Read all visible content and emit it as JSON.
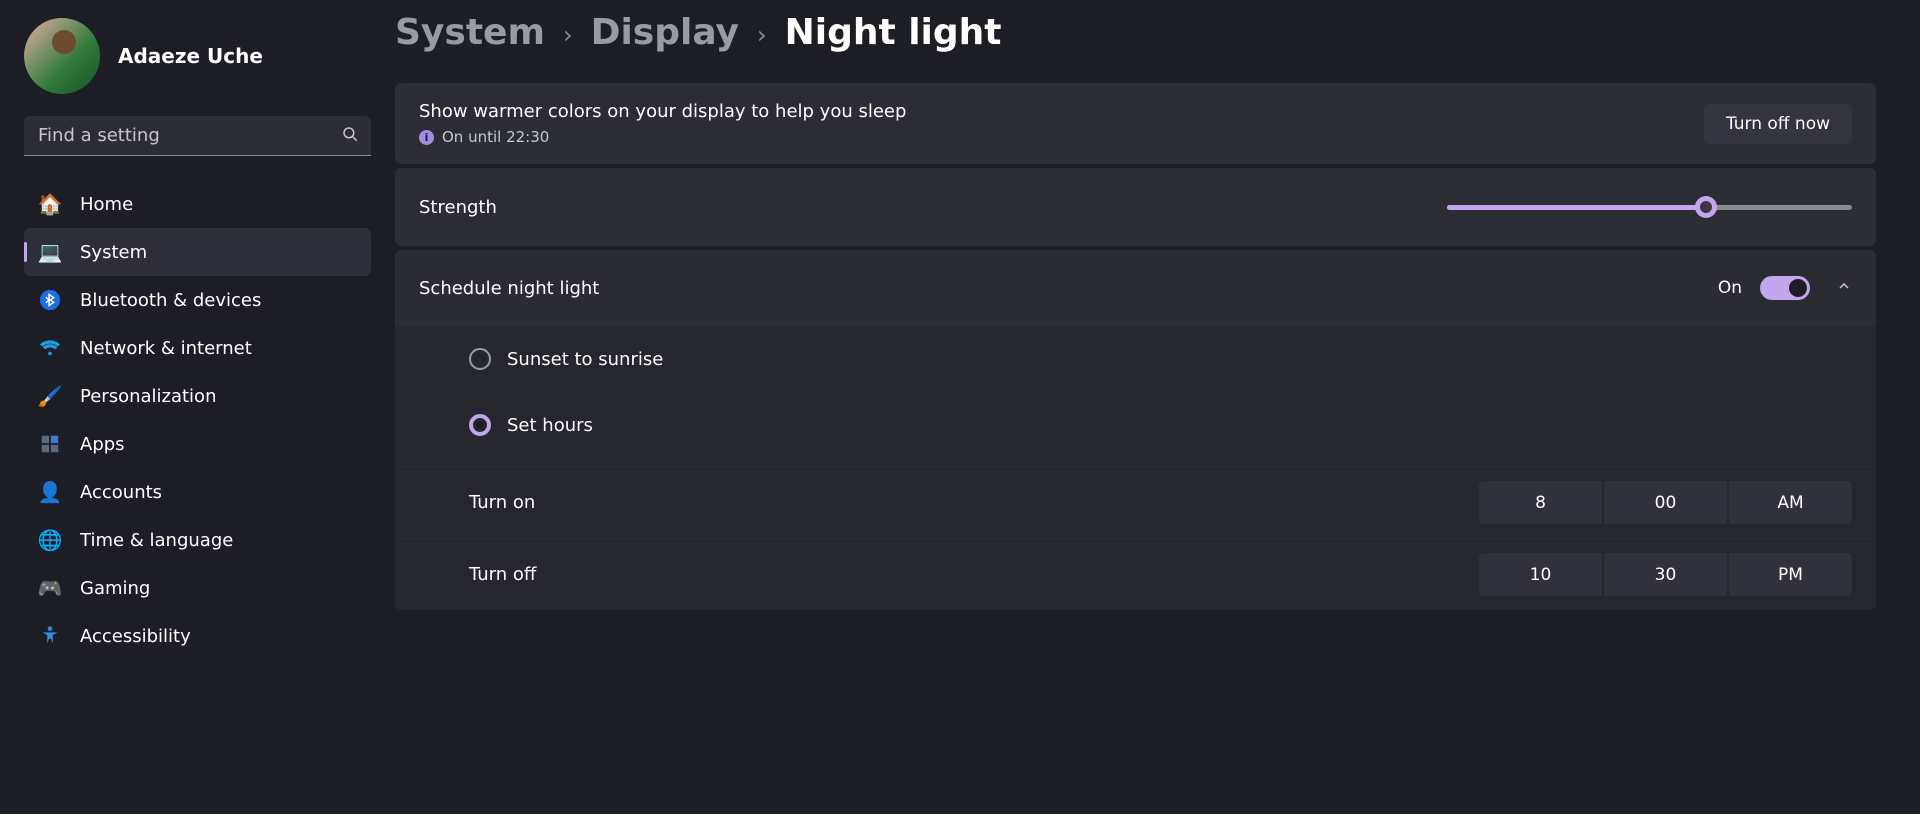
{
  "user": {
    "name": "Adaeze Uche"
  },
  "search": {
    "placeholder": "Find a setting"
  },
  "sidebar": {
    "selected_key": "system",
    "items": [
      {
        "key": "home",
        "label": "Home",
        "icon": "🏠"
      },
      {
        "key": "system",
        "label": "System",
        "icon": "💻"
      },
      {
        "key": "bluetooth",
        "label": "Bluetooth & devices",
        "icon": "bt"
      },
      {
        "key": "network",
        "label": "Network & internet",
        "icon": "wifi"
      },
      {
        "key": "personalization",
        "label": "Personalization",
        "icon": "🖌️"
      },
      {
        "key": "apps",
        "label": "Apps",
        "icon": "apps"
      },
      {
        "key": "accounts",
        "label": "Accounts",
        "icon": "👤"
      },
      {
        "key": "time",
        "label": "Time & language",
        "icon": "🌐"
      },
      {
        "key": "gaming",
        "label": "Gaming",
        "icon": "🎮"
      },
      {
        "key": "accessibility",
        "label": "Accessibility",
        "icon": "acc"
      }
    ]
  },
  "breadcrumb": {
    "parent1": "System",
    "parent2": "Display",
    "current": "Night light"
  },
  "nightlight": {
    "description": "Show warmer colors on your display to help you sleep",
    "status": "On until 22:30",
    "turn_off_label": "Turn off now",
    "strength_label": "Strength",
    "strength_value": 64,
    "schedule": {
      "label": "Schedule night light",
      "toggle_state_text": "On",
      "toggle_on": true,
      "expanded": true,
      "options": {
        "sunset": "Sunset to sunrise",
        "set_hours": "Set hours",
        "selected": "set_hours"
      },
      "turn_on": {
        "label": "Turn on",
        "hour": "8",
        "minute": "00",
        "ampm": "AM"
      },
      "turn_off": {
        "label": "Turn off",
        "hour": "10",
        "minute": "30",
        "ampm": "PM"
      }
    }
  }
}
